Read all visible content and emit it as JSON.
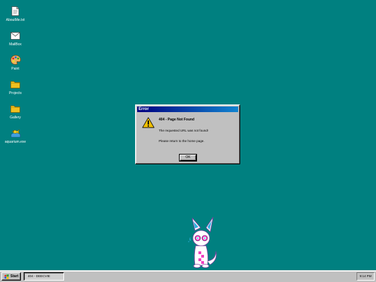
{
  "desktop": {
    "icons": [
      {
        "label": "AboutMe.txt",
        "icon": "document-icon"
      },
      {
        "label": "MailBox",
        "icon": "mail-icon"
      },
      {
        "label": "Paint",
        "icon": "paint-palette-icon"
      },
      {
        "label": "Projects",
        "icon": "folder-icon"
      },
      {
        "label": "Gallery",
        "icon": "folder-icon"
      },
      {
        "label": "aquarium.exe",
        "icon": "aquarium-fish-icon"
      }
    ]
  },
  "dialog": {
    "title": "Error",
    "heading": "404 - Page Not Found",
    "message": "The requested URL was not found!",
    "hint": "Please return to the home page.",
    "ok_label": "OK",
    "icon": "warning-icon"
  },
  "taskbar": {
    "start_label": "Start",
    "task_label": "404 - DEECVIE",
    "clock": "9:14 PM"
  },
  "colors": {
    "desktop": "#008080",
    "titlebar": "#000080",
    "chrome": "#c0c0c0"
  }
}
